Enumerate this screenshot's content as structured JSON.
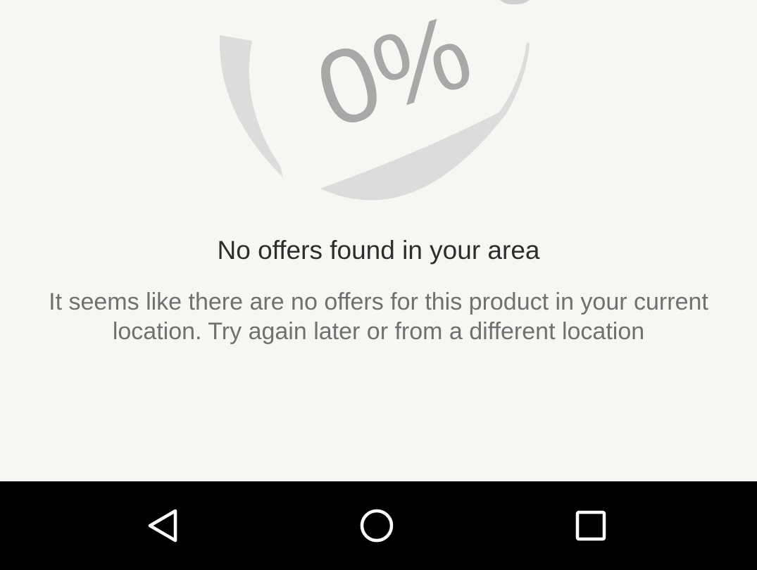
{
  "empty_state": {
    "illustration_icon": "discount-tag-icon",
    "illustration_text": "0%",
    "title": "No offers found in your area",
    "message": "It seems like there are no offers for this product in your current location. Try again later or from a different location"
  },
  "navigation_bar": {
    "back_icon": "back-triangle-icon",
    "home_icon": "home-circle-icon",
    "recents_icon": "recents-square-icon"
  },
  "colors": {
    "background": "#f7f6f3",
    "illustration_light": "#dcdcdc",
    "illustration_dark": "#a8a8a8",
    "title_text": "#2d2d2d",
    "message_text": "#707070",
    "navbar": "#000000",
    "nav_icons": "#ffffff"
  }
}
